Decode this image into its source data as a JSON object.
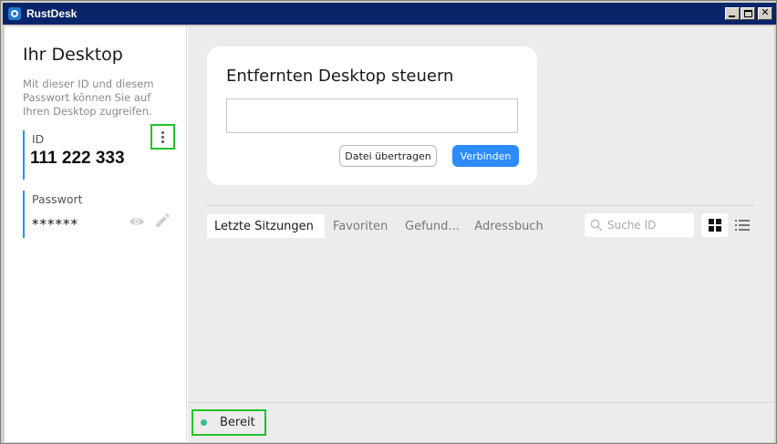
{
  "window": {
    "title": "RustDesk",
    "icon": "rustdesk-logo-icon",
    "controls": [
      "minimize-icon",
      "maximize-icon",
      "close-icon"
    ]
  },
  "left": {
    "title": "Ihr Desktop",
    "description": "Mit dieser ID und diesem Passwort können Sie auf Ihren Desktop zugreifen.",
    "id_label": "ID",
    "id_value": "111 222 333",
    "password_label": "Passwort",
    "password_value": "******",
    "icons": [
      "more-vertical-icon",
      "eye-icon",
      "pencil-icon"
    ]
  },
  "remote": {
    "title": "Entfernten Desktop steuern",
    "input_value": "",
    "transfer_label": "Datei übertragen",
    "connect_label": "Verbinden"
  },
  "tabs": [
    {
      "label": "Letzte Sitzungen",
      "active": true
    },
    {
      "label": "Favoriten",
      "active": false
    },
    {
      "label": "Gefund...",
      "active": false
    },
    {
      "label": "Adressbuch",
      "active": false
    }
  ],
  "search": {
    "placeholder": "Suche ID",
    "icon": "search-icon"
  },
  "view": {
    "selected": "grid",
    "icons": [
      "grid-view-icon",
      "list-view-icon"
    ]
  },
  "status": {
    "text": "Bereit",
    "color": "#3cbf8c"
  },
  "colors": {
    "accent": "#2c8cff",
    "highlight_box": "#22c02a",
    "titlebar": "#0a246a"
  }
}
